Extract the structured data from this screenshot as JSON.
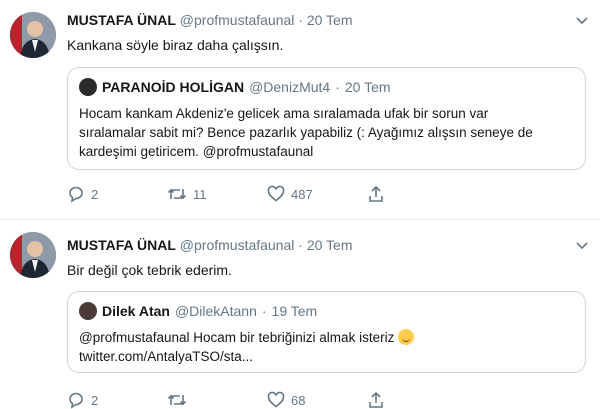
{
  "tweets": [
    {
      "author_name": "MUSTAFA ÜNAL",
      "author_handle": "@profmustafaunal",
      "separator": "·",
      "date": "20 Tem",
      "text": "Kankana söyle biraz daha çalışsın.",
      "quote": {
        "author_name": "PARANOİD HOLİGAN",
        "author_handle": "@DenizMut4",
        "separator": "·",
        "date": "20 Tem",
        "line1": "Hocam kankam Akdeniz'e gelicek ama sıralamada ufak bir sorun var",
        "line2": "sıralamalar sabit mi? Bence pazarlık yapabiliz (: Ayağımız alışsın seneye de",
        "line3": "kardeşimi getiricem. @profmustafaunal"
      },
      "reply_count": "2",
      "retweet_count": "11",
      "like_count": "487"
    },
    {
      "author_name": "MUSTAFA ÜNAL",
      "author_handle": "@profmustafaunal",
      "separator": "·",
      "date": "20 Tem",
      "text": "Bir değil çok tebrik ederim.",
      "quote": {
        "author_name": "Dilek Atan",
        "author_handle": "@DilekAtann",
        "separator": "·",
        "date": "19 Tem",
        "line1": "@profmustafaunal Hocam bir tebriğinizi almak isteriz",
        "line2": "twitter.com/AntalyaTSO/sta..."
      },
      "reply_count": "2",
      "retweet_count": "",
      "like_count": "68"
    }
  ],
  "icons": {
    "chevron": "chevron-down-icon",
    "reply": "reply-icon",
    "retweet": "retweet-icon",
    "like": "heart-icon",
    "share": "share-icon",
    "emoji": "relieved-face-emoji"
  },
  "colors": {
    "text": "#14171a",
    "muted": "#657786",
    "border": "#ccd6dd",
    "divider": "#e6ecf0"
  }
}
